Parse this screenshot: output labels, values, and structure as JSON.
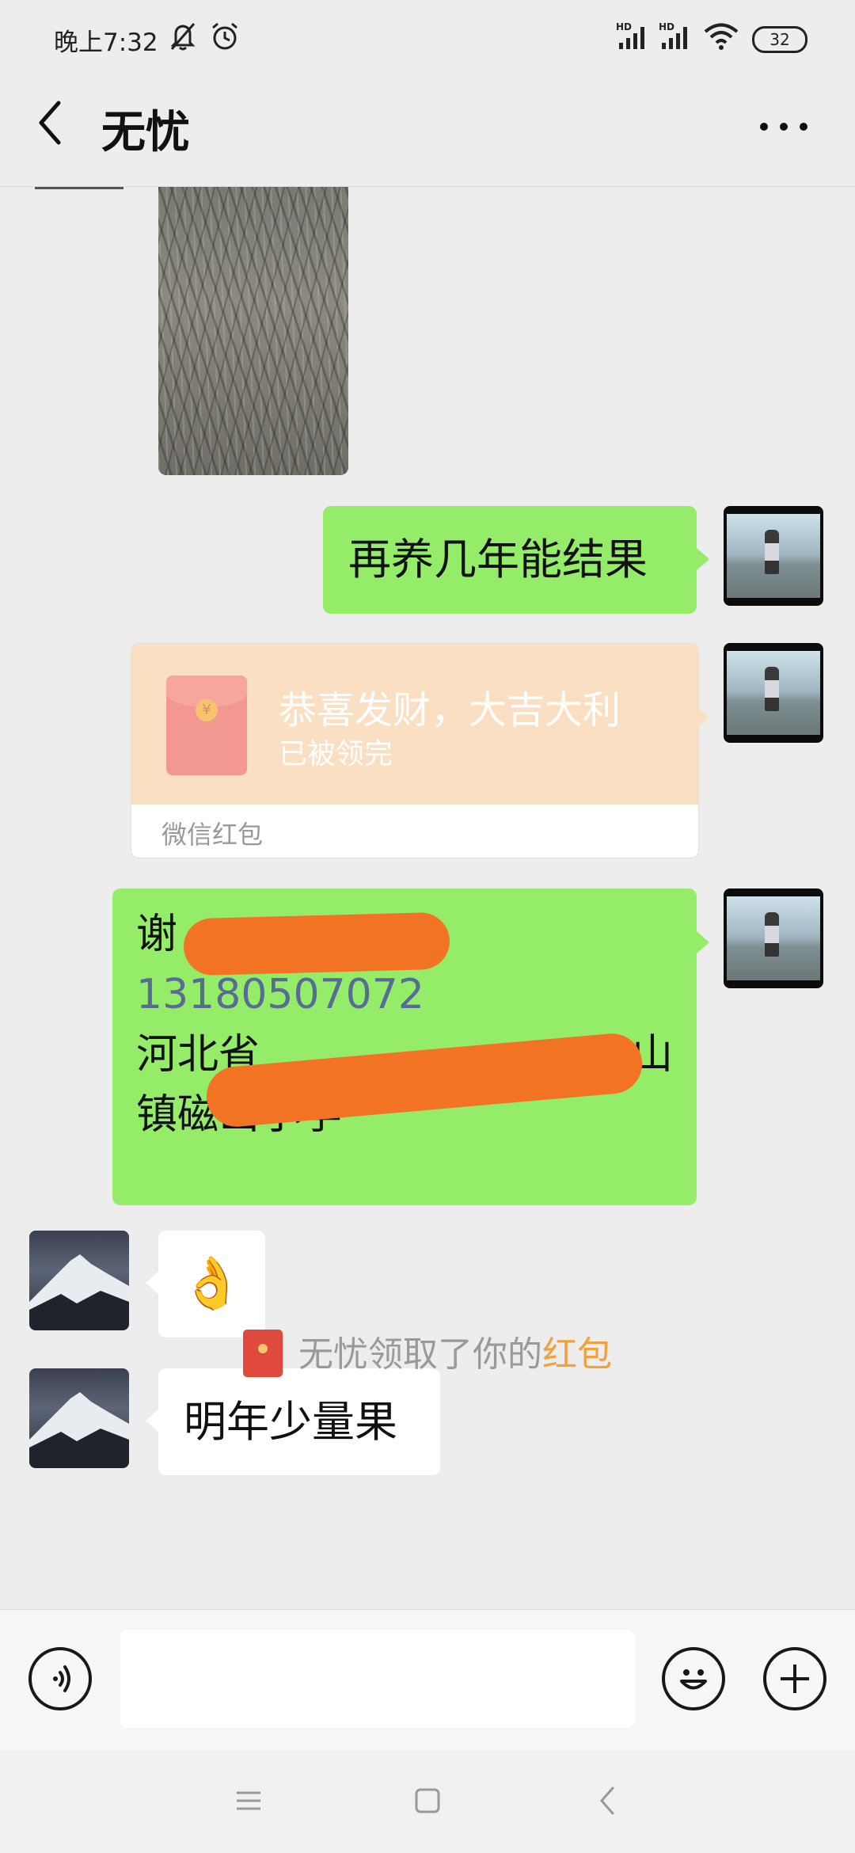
{
  "status_bar": {
    "time": "晚上7:32",
    "battery": "32",
    "icons": [
      "mute-icon",
      "alarm-icon",
      "hd-signal-icon",
      "hd-signal-icon",
      "wifi-icon",
      "battery-icon"
    ]
  },
  "header": {
    "title": "无忧",
    "back_icon": "chevron-left-icon",
    "more_icon": "more-dots-icon"
  },
  "messages": [
    {
      "type": "image",
      "from": "other",
      "description_icon": "photo-thumbnail"
    },
    {
      "type": "text",
      "from": "me",
      "text": "再养几年能结果"
    },
    {
      "type": "red_packet",
      "from": "me",
      "title": "恭喜发财，大吉大利",
      "status": "已被领完",
      "label": "微信红包"
    },
    {
      "type": "text",
      "from": "me",
      "lines": [
        "谢",
        "13180507072",
        "河北省",
        "山",
        "镇磁山小学"
      ]
    },
    {
      "type": "emoji",
      "from": "other",
      "emoji": "👌"
    },
    {
      "type": "text",
      "from": "other",
      "text": "明年少量果"
    }
  ],
  "system_notice": {
    "prefix": "无忧领取了你的",
    "link": "红包"
  },
  "input_bar": {
    "voice_icon": "voice-icon",
    "emoji_icon": "emoji-icon",
    "plus_icon": "plus-icon",
    "input_value": ""
  },
  "system_nav": {
    "icons": [
      "menu-icon",
      "home-icon",
      "back-icon"
    ]
  },
  "colors": {
    "background": "#ededed",
    "my_bubble": "#95ec69",
    "other_bubble": "#ffffff",
    "red_packet_bg": "#fbdfc2",
    "link_accent": "#f0a13c",
    "phone_link": "#576b95"
  }
}
